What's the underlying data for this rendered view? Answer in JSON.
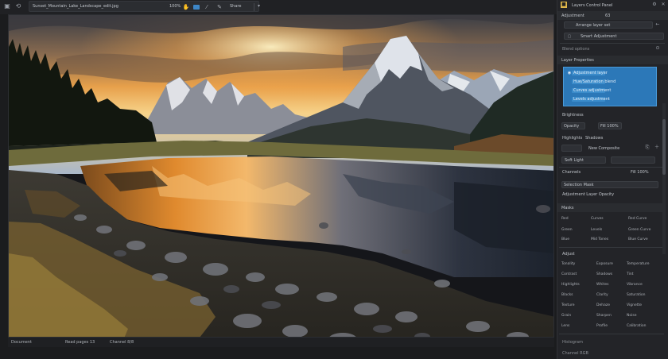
{
  "topbar": {
    "path": "Sunset_Mountain_Lake_Landscape_edit.jpg",
    "zoom": "100%",
    "action": "Share",
    "caret": "▾"
  },
  "statusbar": {
    "left": "Document",
    "middle": "Read pages 13",
    "right": "Channel 8/8"
  },
  "panel": {
    "title": "Layers Control Panel",
    "header1": "Adjustment",
    "header1_value": "63",
    "field1": "Arrange layer set",
    "field2": "Smart Adjustment",
    "section_blend": "Blend options",
    "group_title": "Layer Properties",
    "list_items": [
      "Adjustment layer",
      "Hue/Saturation blend",
      "Curves adjustment",
      "Levels adjustment"
    ],
    "brightness_label": "Brightness",
    "filter_label": "Opacity",
    "filter_value": "Fill 100%",
    "layers_label": "Highlights",
    "layers_value": "Shadows",
    "view_label": "New Composite",
    "blend_mode": "Soft Light",
    "channels_label": "Channels",
    "channels_value": "Fill 100%",
    "sub_header": "Selection Mask",
    "sub_header2": "Adjustment Layer Opacity",
    "masks_label": "Masks",
    "mask_rows": [
      {
        "a": "Red",
        "b": "Curves",
        "c": "Red Curve"
      },
      {
        "a": "Green",
        "b": "Levels",
        "c": "Green Curve"
      },
      {
        "a": "Blue",
        "b": "Mid Tones",
        "c": "Blue Curve"
      }
    ],
    "adjust_label": "Adjust",
    "adjust_rows": [
      {
        "a": "Tonality",
        "b": "Exposure",
        "c": "Temperature"
      },
      {
        "a": "Contrast",
        "b": "Shadows",
        "c": "Tint"
      },
      {
        "a": "Highlights",
        "b": "Whites",
        "c": "Vibrance"
      },
      {
        "a": "Blacks",
        "b": "Clarity",
        "c": "Saturation"
      },
      {
        "a": "Texture",
        "b": "Dehaze",
        "c": "Vignette"
      },
      {
        "a": "Grain",
        "b": "Sharpen",
        "c": "Noise"
      },
      {
        "a": "Lens",
        "b": "Profile",
        "c": "Calibration"
      }
    ],
    "footer_label": "Histogram",
    "footer_value": "Channel RGB"
  },
  "icons": {
    "back": "back-icon",
    "forward": "forward-icon",
    "hand": "hand-icon",
    "brush": "brush-icon",
    "pen": "pen-icon",
    "settings": "gear-icon"
  },
  "colors": {
    "accent": "#2c78b8",
    "panel_bg": "#232428",
    "canvas_bg": "#15161a"
  }
}
